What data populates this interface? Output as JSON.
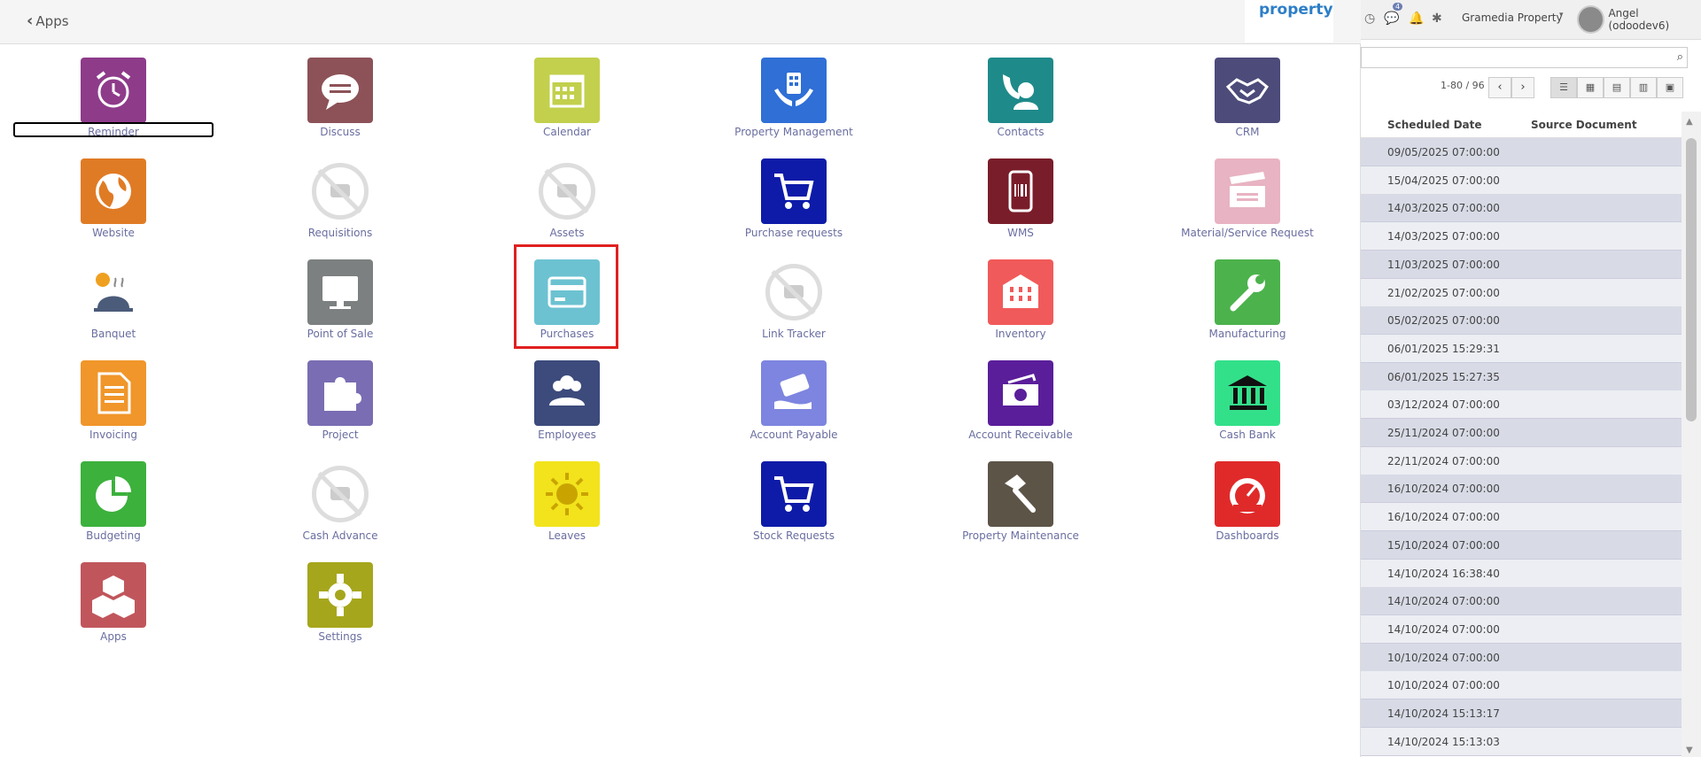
{
  "header": {
    "back_label": "Apps",
    "logo_text": "property"
  },
  "topbar": {
    "messages_badge": "4",
    "company": "Gramedia Property",
    "user": "Angel (odoodev6)"
  },
  "list": {
    "pager": "1-80 / 96",
    "columns": [
      "Scheduled Date",
      "Source Document"
    ],
    "rows": [
      "09/05/2025 07:00:00",
      "15/04/2025 07:00:00",
      "14/03/2025 07:00:00",
      "14/03/2025 07:00:00",
      "11/03/2025 07:00:00",
      "21/02/2025 07:00:00",
      "05/02/2025 07:00:00",
      "06/01/2025 15:29:31",
      "06/01/2025 15:27:35",
      "03/12/2024 07:00:00",
      "25/11/2024 07:00:00",
      "22/11/2024 07:00:00",
      "16/10/2024 07:00:00",
      "16/10/2024 07:00:00",
      "15/10/2024 07:00:00",
      "14/10/2024 16:38:40",
      "14/10/2024 07:00:00",
      "14/10/2024 07:00:00",
      "10/10/2024 07:00:00",
      "10/10/2024 07:00:00",
      "14/10/2024 15:13:17",
      "14/10/2024 15:13:03"
    ]
  },
  "apps": [
    {
      "label": "Reminder",
      "icon": "alarm-clock-icon",
      "color": "#8e3b8a"
    },
    {
      "label": "Discuss",
      "icon": "chat-bubble-icon",
      "color": "#8c5257"
    },
    {
      "label": "Calendar",
      "icon": "calendar-icon",
      "color": "#c2d04d"
    },
    {
      "label": "Property Management",
      "icon": "building-hands-icon",
      "color": "#2f6fd6"
    },
    {
      "label": "Contacts",
      "icon": "contact-phone-icon",
      "color": "#1f8a8a"
    },
    {
      "label": "CRM",
      "icon": "handshake-icon",
      "color": "#4c4b7a"
    },
    {
      "label": "Website",
      "icon": "globe-icon",
      "color": "#e07b25"
    },
    {
      "label": "Requisitions",
      "icon": "no-image-icon",
      "color": ""
    },
    {
      "label": "Assets",
      "icon": "no-image-icon",
      "color": ""
    },
    {
      "label": "Purchase requests",
      "icon": "cart-icon",
      "color": "#0d1ba8"
    },
    {
      "label": "WMS",
      "icon": "barcode-phone-icon",
      "color": "#7a1d2a"
    },
    {
      "label": "Material/Service Request",
      "icon": "clapper-icon",
      "color": "#e8b3c2"
    },
    {
      "label": "Banquet",
      "icon": "cloche-icon",
      "color": ""
    },
    {
      "label": "Point of Sale",
      "icon": "monitor-icon",
      "color": "#7c8080"
    },
    {
      "label": "Purchases",
      "icon": "credit-card-icon",
      "color": "#6cc2d1"
    },
    {
      "label": "Link Tracker",
      "icon": "no-image-icon",
      "color": ""
    },
    {
      "label": "Inventory",
      "icon": "warehouse-icon",
      "color": "#f15a5a"
    },
    {
      "label": "Manufacturing",
      "icon": "wrench-icon",
      "color": "#4cb24c"
    },
    {
      "label": "Invoicing",
      "icon": "document-icon",
      "color": "#f0962a"
    },
    {
      "label": "Project",
      "icon": "puzzle-icon",
      "color": "#7a6db3"
    },
    {
      "label": "Employees",
      "icon": "people-icon",
      "color": "#3c4b7c"
    },
    {
      "label": "Account Payable",
      "icon": "money-hand-icon",
      "color": "#7d85e0"
    },
    {
      "label": "Account Receivable",
      "icon": "cash-icon",
      "color": "#5a1e9a"
    },
    {
      "label": "Cash Bank",
      "icon": "bank-icon",
      "color": "#33e08a"
    },
    {
      "label": "Budgeting",
      "icon": "pie-chart-icon",
      "color": "#3cb13c"
    },
    {
      "label": "Cash Advance",
      "icon": "no-image-icon",
      "color": ""
    },
    {
      "label": "Leaves",
      "icon": "sun-icon",
      "color": "#f2e31c"
    },
    {
      "label": "Stock Requests",
      "icon": "cart-icon",
      "color": "#0d1ba8"
    },
    {
      "label": "Property Maintenance",
      "icon": "hammer-icon",
      "color": "#5c5447"
    },
    {
      "label": "Dashboards",
      "icon": "gauge-icon",
      "color": "#e02a2a"
    },
    {
      "label": "Apps",
      "icon": "cubes-icon",
      "color": "#c0565c"
    },
    {
      "label": "Settings",
      "icon": "gear-icon",
      "color": "#a6a61c"
    }
  ]
}
